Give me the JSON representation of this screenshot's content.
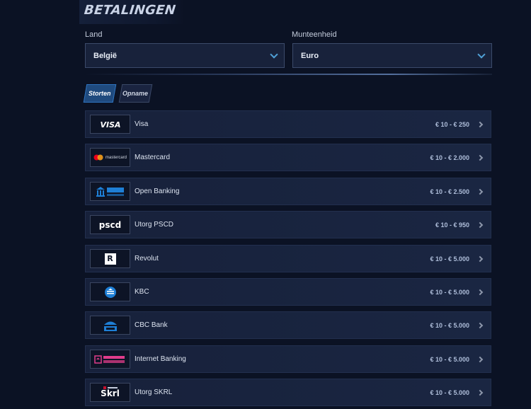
{
  "page": {
    "title": "BETALINGEN"
  },
  "filters": {
    "country": {
      "label": "Land",
      "value": "België"
    },
    "currency": {
      "label": "Munteenheid",
      "value": "Euro"
    }
  },
  "tabs": [
    {
      "label": "Storten",
      "active": true
    },
    {
      "label": "Opname",
      "active": false
    }
  ],
  "methods": [
    {
      "name": "Visa",
      "range": "€ 10 - € 250",
      "logo": "visa-logo"
    },
    {
      "name": "Mastercard",
      "range": "€ 10 - € 2.000",
      "logo": "mastercard-logo",
      "logo_text": "mastercard"
    },
    {
      "name": "Open Banking",
      "range": "€ 10 - € 2.500",
      "logo": "bank-transfer-logo"
    },
    {
      "name": "Utorg PSCD",
      "range": "€ 10 - € 950",
      "logo": "pscd-logo",
      "logo_text": "pscd"
    },
    {
      "name": "Revolut",
      "range": "€ 10 - € 5.000",
      "logo": "revolut-logo",
      "logo_text": "R"
    },
    {
      "name": "KBC",
      "range": "€ 10 - € 5.000",
      "logo": "kbc-logo"
    },
    {
      "name": "CBC Bank",
      "range": "€ 10 - € 5.000",
      "logo": "cbc-logo"
    },
    {
      "name": "Internet Banking",
      "range": "€ 10 - € 5.000",
      "logo": "internet-banking-logo"
    },
    {
      "name": "Utorg SKRL",
      "range": "€ 10 - € 5.000",
      "logo": "skrill-logo",
      "logo_text": "Skrl"
    }
  ],
  "colors": {
    "background": "#0b1224",
    "row": "#18223d",
    "accent": "#2f74c0",
    "mastercard_red": "#eb001b",
    "mastercard_orange": "#f79e1b",
    "bank_blue": "#1e7fd6",
    "internet_banking_pink": "#e03c8a",
    "skrill_red": "#c8102e"
  }
}
